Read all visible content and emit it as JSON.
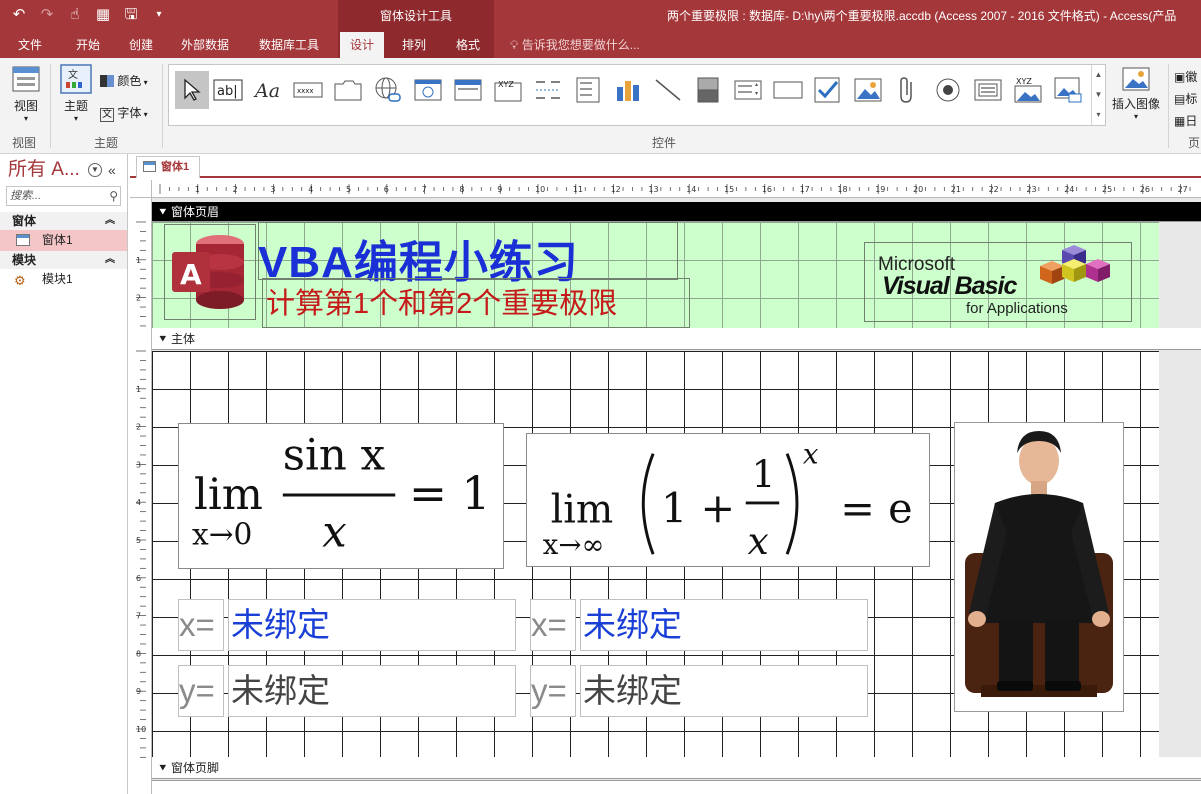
{
  "titlebar": {
    "context_tools": "窗体设计工具",
    "window_title": "两个重要极限 : 数据库- D:\\hy\\两个重要极限.accdb (Access 2007 - 2016 文件格式) - Access(产品"
  },
  "tabs": [
    {
      "label": "文件"
    },
    {
      "label": "开始"
    },
    {
      "label": "创建"
    },
    {
      "label": "外部数据"
    },
    {
      "label": "数据库工具"
    },
    {
      "label": "设计"
    },
    {
      "label": "排列"
    },
    {
      "label": "格式"
    }
  ],
  "tell_me": "告诉我您想要做什么...",
  "ribbon": {
    "view_label": "视图",
    "view_group": "视图",
    "theme_label": "主题",
    "colors_label": "颜色",
    "fonts_label": "字体",
    "theme_group": "主题",
    "controls_group": "控件",
    "insert_image_label": "插入图像",
    "right_group_partial": "页",
    "right_items": [
      "徽",
      "标",
      "日"
    ]
  },
  "nav": {
    "header": "所有 A...",
    "search_placeholder": "搜索...",
    "sections": [
      {
        "label": "窗体",
        "items": [
          "窗体1"
        ]
      },
      {
        "label": "模块",
        "items": [
          "模块1"
        ]
      }
    ]
  },
  "document_tab": "窗体1",
  "sections": {
    "header": "窗体页眉",
    "detail": "主体",
    "footer": "窗体页脚"
  },
  "form_header": {
    "title": "VBA编程小练习",
    "subtitle": "计算第1个和第2个重要极限",
    "vb_logo_line1": "Microsoft",
    "vb_logo_line2": "Visual Basic",
    "vb_logo_line3": "for Applications"
  },
  "formulas": {
    "lim": "lim",
    "left_sub": "x→0",
    "left_num": "sin x",
    "left_den": "x",
    "left_rhs": "= 1",
    "right_sub": "x→∞",
    "right_one": "1 +",
    "right_frac_num": "1",
    "right_frac_den": "x",
    "right_exp": "x",
    "right_rhs": "= e"
  },
  "controls": {
    "x_label": "x=",
    "y_label": "y=",
    "unbound": "未绑定"
  },
  "colors": {
    "accent": "#a4373a",
    "header_bg": "#ccffcc",
    "title_blue": "#1a2fd6",
    "subtitle_red": "#c61a1a"
  }
}
